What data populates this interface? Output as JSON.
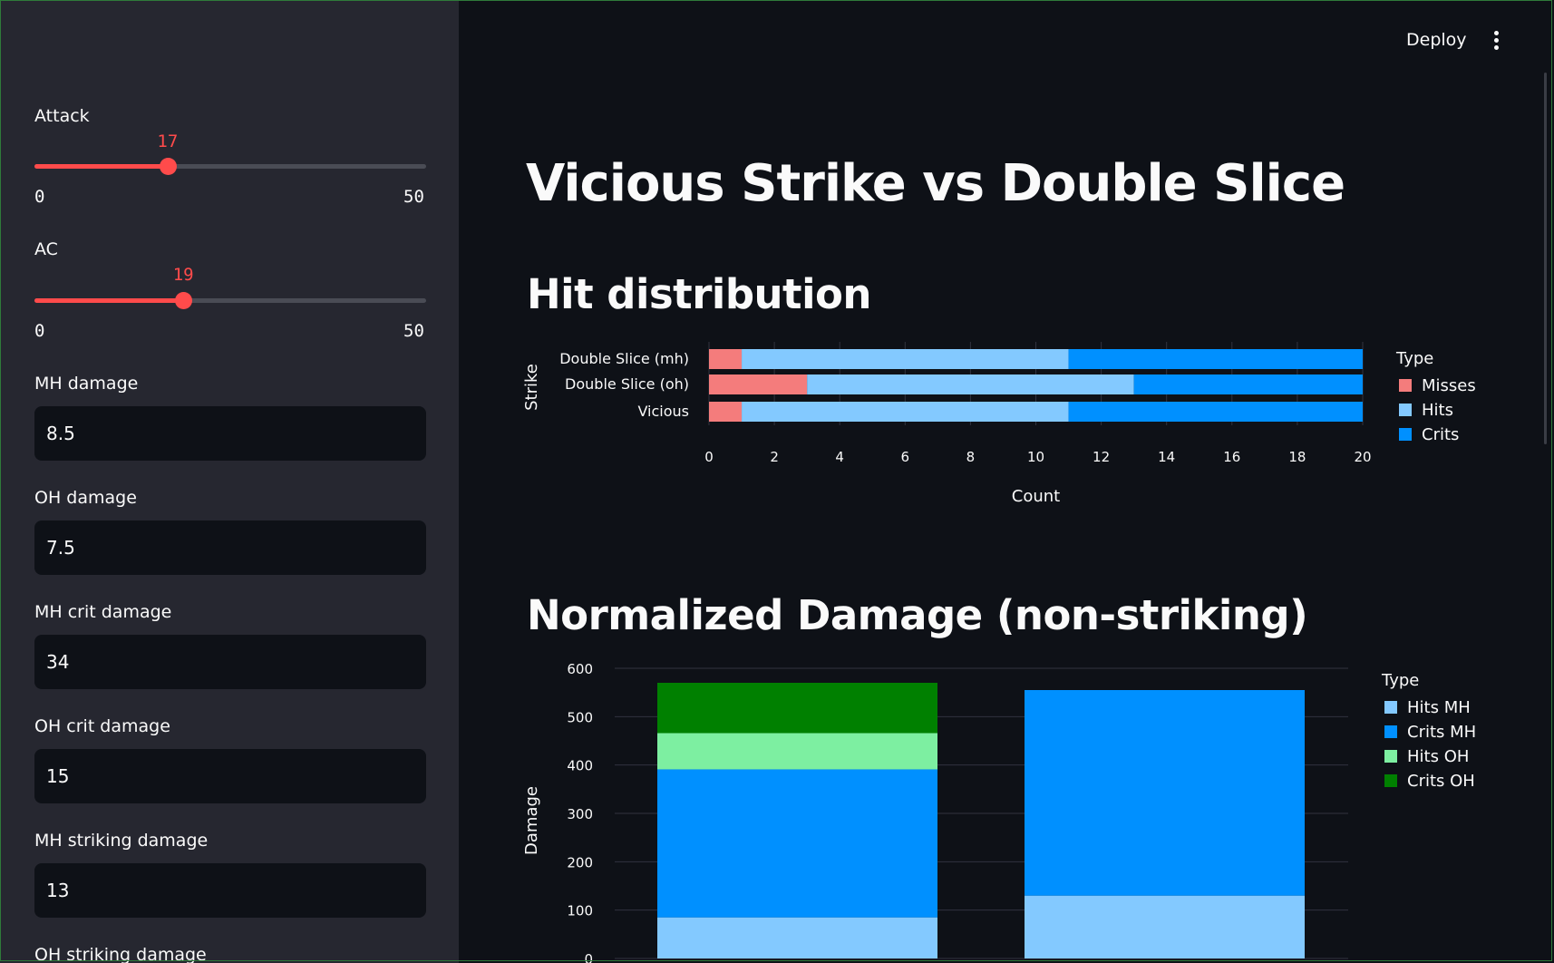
{
  "toolbar": {
    "deploy_label": "Deploy",
    "menu_icon": "kebab-menu-icon"
  },
  "sidebar": {
    "sliders": [
      {
        "label": "Attack",
        "value": "17",
        "min": "0",
        "max": "50",
        "fraction": 0.34
      },
      {
        "label": "AC",
        "value": "19",
        "min": "0",
        "max": "50",
        "fraction": 0.38
      }
    ],
    "inputs": [
      {
        "label": "MH damage",
        "value": "8.5"
      },
      {
        "label": "OH damage",
        "value": "7.5"
      },
      {
        "label": "MH crit damage",
        "value": "34"
      },
      {
        "label": "OH crit damage",
        "value": "15"
      },
      {
        "label": "MH striking damage",
        "value": "13"
      },
      {
        "label": "OH striking damage",
        "value": ""
      }
    ]
  },
  "main": {
    "title": "Vicious Strike vs Double Slice",
    "section1": "Hit distribution",
    "section2": "Normalized Damage (non-striking)"
  },
  "colors": {
    "accent": "#ff4b4b",
    "misses": "#f47c7c",
    "hits": "#83c9ff",
    "crits": "#0090ff",
    "hits_oh": "#7defa1",
    "crits_oh": "#008000"
  },
  "chart_data": [
    {
      "type": "bar",
      "orientation": "horizontal-stacked",
      "title": "",
      "xlabel": "Count",
      "ylabel": "Strike",
      "xlim": [
        0,
        20
      ],
      "x_ticks": [
        "0",
        "2",
        "4",
        "6",
        "8",
        "10",
        "12",
        "14",
        "16",
        "18",
        "20"
      ],
      "categories": [
        "Double Slice (mh)",
        "Double Slice (oh)",
        "Vicious"
      ],
      "legend_title": "Type",
      "legend_position": "right",
      "series": [
        {
          "name": "Misses",
          "color": "#f47c7c",
          "values": [
            1,
            3,
            1
          ]
        },
        {
          "name": "Hits",
          "color": "#83c9ff",
          "values": [
            10,
            10,
            10
          ]
        },
        {
          "name": "Crits",
          "color": "#0090ff",
          "values": [
            9,
            7,
            9
          ]
        }
      ],
      "grid": true
    },
    {
      "type": "bar",
      "orientation": "vertical-stacked",
      "title": "",
      "xlabel": "",
      "ylabel": "Damage",
      "ylim": [
        0,
        600
      ],
      "y_ticks": [
        "0",
        "100",
        "200",
        "300",
        "400",
        "500",
        "600"
      ],
      "categories": [
        "",
        ""
      ],
      "legend_title": "Type",
      "legend_position": "right",
      "series": [
        {
          "name": "Hits MH",
          "color": "#83c9ff",
          "values": [
            85,
            130
          ]
        },
        {
          "name": "Crits MH",
          "color": "#0090ff",
          "values": [
            306,
            425
          ]
        },
        {
          "name": "Hits OH",
          "color": "#7defa1",
          "values": [
            75,
            0
          ]
        },
        {
          "name": "Crits OH",
          "color": "#008000",
          "values": [
            104,
            0
          ]
        }
      ],
      "grid": true
    }
  ]
}
